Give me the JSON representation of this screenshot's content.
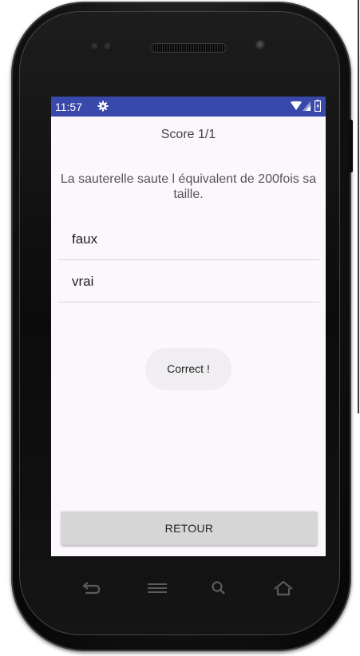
{
  "status_bar": {
    "time": "11:57",
    "icons": [
      "gear-icon",
      "wifi-icon",
      "signal-icon",
      "battery-icon"
    ],
    "background": "#3949ab"
  },
  "quiz": {
    "score": "Score 1/1",
    "question": "La sauterelle saute l équivalent de 200fois sa taille.",
    "options": [
      {
        "label": "faux"
      },
      {
        "label": "vrai"
      }
    ],
    "toast": "Correct !",
    "back_button": "RETOUR"
  },
  "device": {
    "nav_keys": [
      "back-icon",
      "menu-icon",
      "search-icon",
      "home-icon"
    ]
  },
  "colors": {
    "screen_background": "#fbf7fd",
    "button_background": "#d6d6d6",
    "toast_background": "#f1eef2"
  }
}
